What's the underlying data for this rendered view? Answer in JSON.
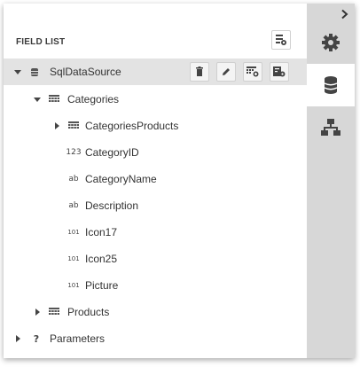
{
  "panel": {
    "title": "FIELD LIST"
  },
  "tree": {
    "datasource": {
      "label": "SqlDataSource",
      "expanded": true
    },
    "categories": {
      "label": "Categories",
      "expanded": true
    },
    "fields": [
      {
        "label": "CategoriesProducts",
        "type_icon": "table-icon",
        "has_children": true
      },
      {
        "label": "CategoryID",
        "type_icon": "123"
      },
      {
        "label": "CategoryName",
        "type_icon": "ab"
      },
      {
        "label": "Description",
        "type_icon": "ab"
      },
      {
        "label": "Icon17",
        "type_icon": "101"
      },
      {
        "label": "Icon25",
        "type_icon": "101"
      },
      {
        "label": "Picture",
        "type_icon": "101"
      }
    ],
    "products": {
      "label": "Products",
      "expanded": false
    },
    "parameters": {
      "label": "Parameters",
      "type_icon": "?",
      "expanded": false
    }
  },
  "colors": {
    "selected_row": "#e3e3e3",
    "side_panel": "#d7d7d7",
    "text": "#333333"
  }
}
